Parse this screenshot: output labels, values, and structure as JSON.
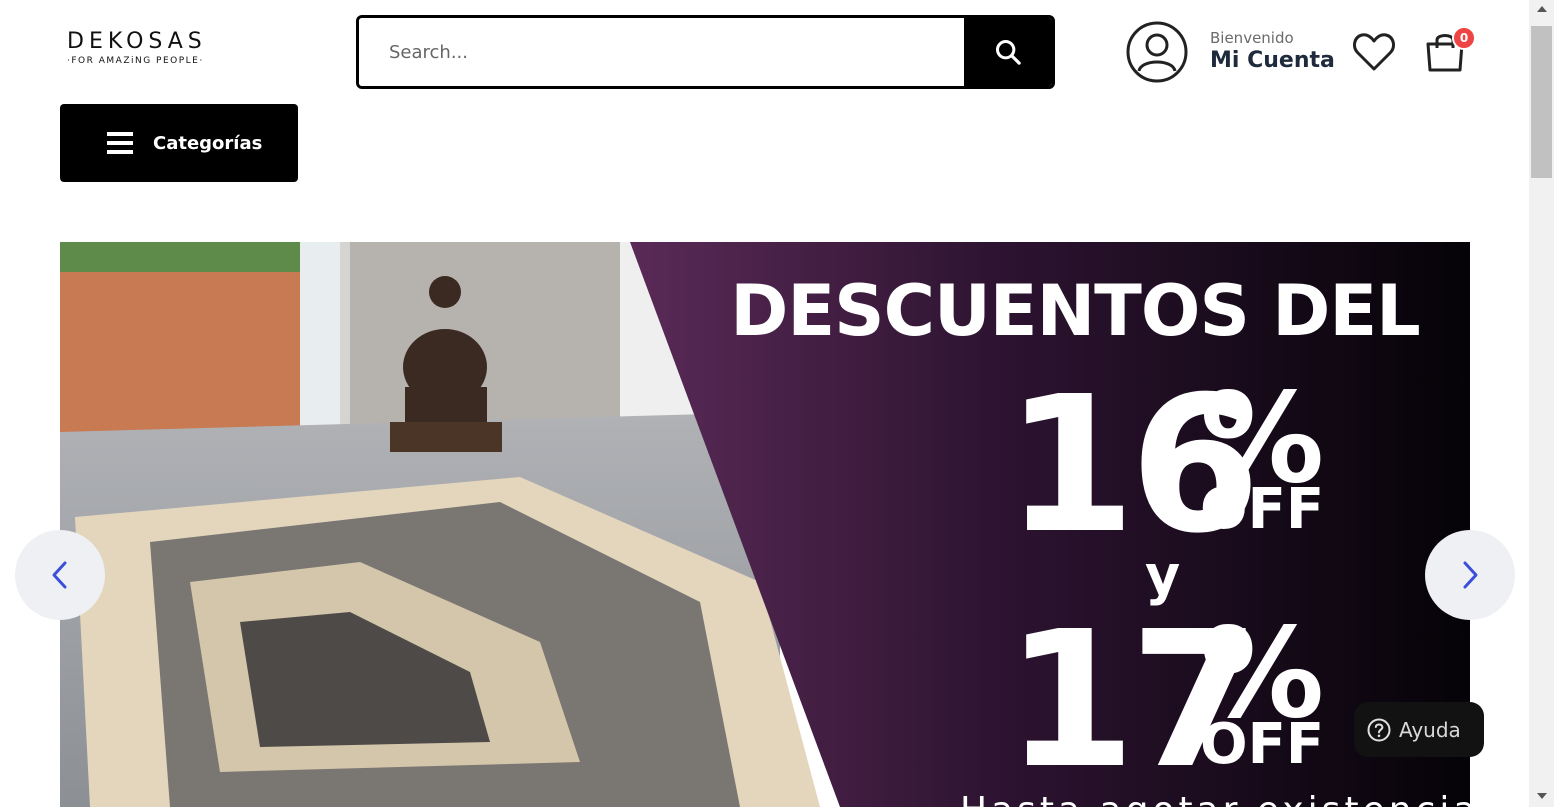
{
  "header": {
    "logo": {
      "name": "DEKOSAS",
      "tagline": "·FOR AMAZiNG PEOPLE·"
    },
    "search": {
      "placeholder": "Search...",
      "value": ""
    },
    "account": {
      "greeting": "Bienvenido",
      "label": "Mi Cuenta"
    },
    "cart": {
      "count": "0"
    },
    "categories_label": "Categorías"
  },
  "banner": {
    "headline": "DESCUENTOS DEL",
    "discount_1": "16",
    "discount_2": "17",
    "percent_symbol": "%",
    "off_label": "OFF",
    "connector": "y",
    "footnote": "Hasta agotar existencias"
  },
  "help": {
    "label": "Ayuda"
  },
  "colors": {
    "primary": "#000000",
    "badge": "#ef4444",
    "arrow": "#3b4fd8",
    "promo_purple": "#5a2a57"
  },
  "icons": [
    "search-icon",
    "user-icon",
    "heart-icon",
    "shopping-bag-icon",
    "menu-icon",
    "chevron-left-icon",
    "chevron-right-icon",
    "question-icon"
  ]
}
